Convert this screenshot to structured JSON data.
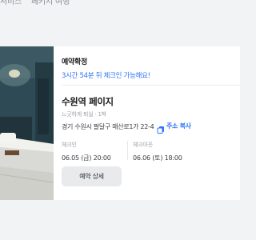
{
  "tabs": [
    "서비스",
    "페키지 여행"
  ],
  "reservation": {
    "status_title": "예약확정",
    "status_message": "3시간 54분 뒤 체크인 가능해요!",
    "hotel_name": "수원역 페이지",
    "stay_info": "느긋하게 퇴실 · 1박",
    "address": "경기 수원시 팔달구 매산로1가 22-4",
    "copy_address_label": "주소 복사",
    "checkin": {
      "label": "체크인",
      "value": "06.05 (금) 20:00"
    },
    "checkout": {
      "label": "체크아웃",
      "value": "06.06 (토) 18:00"
    },
    "detail_button_label": "예약 상세"
  },
  "colors": {
    "accent": "#2f73f5",
    "background": "#f2f3f5",
    "card": "#ffffff"
  },
  "icons": {
    "copy": "copy-icon"
  }
}
